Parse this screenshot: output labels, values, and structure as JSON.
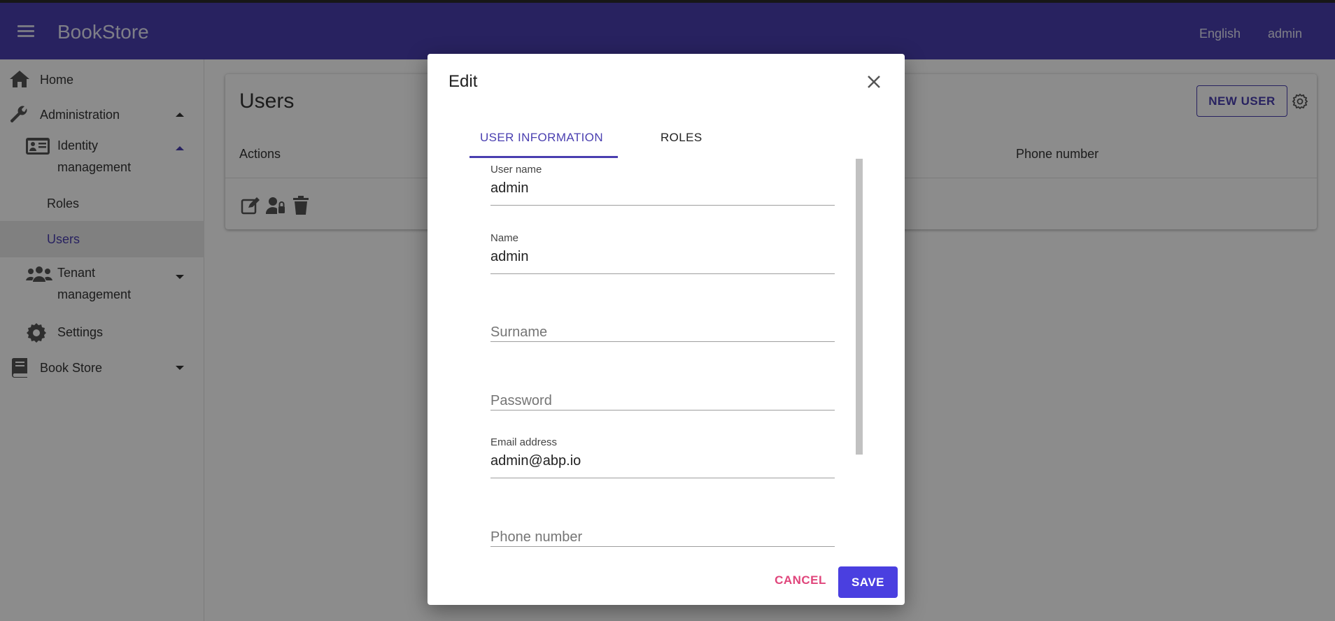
{
  "appbar": {
    "title": "BookStore",
    "language": "English",
    "user": "admin"
  },
  "sidebar": {
    "home": "Home",
    "administration": "Administration",
    "identity_line1": "Identity",
    "identity_line2": "management",
    "roles": "Roles",
    "users": "Users",
    "tenant_line1": "Tenant",
    "tenant_line2": "management",
    "settings": "Settings",
    "book_store": "Book Store"
  },
  "main": {
    "title": "Users",
    "new_user": "NEW USER",
    "col_actions": "Actions",
    "col_phone": "Phone number"
  },
  "dialog": {
    "title": "Edit",
    "tab_info": "USER INFORMATION",
    "tab_roles": "ROLES",
    "username_label": "User name",
    "username_value": "admin",
    "name_label": "Name",
    "name_value": "admin",
    "surname_placeholder": "Surname",
    "password_placeholder": "Password",
    "email_label": "Email address",
    "email_value": "admin@abp.io",
    "phone_placeholder": "Phone number",
    "cancel": "CANCEL",
    "save": "SAVE"
  },
  "colors": {
    "primary": "#4a3fb0",
    "accent": "#e0457b",
    "save": "#4a3fe0"
  }
}
